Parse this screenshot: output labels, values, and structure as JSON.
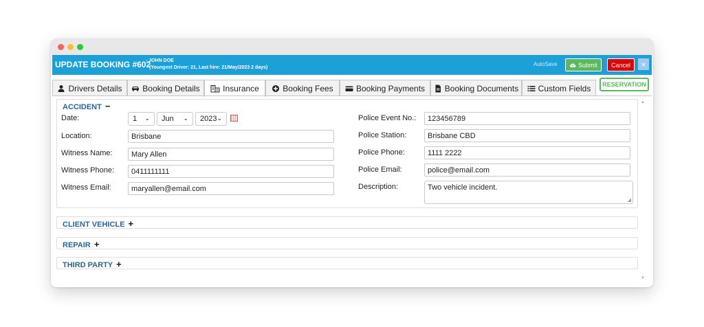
{
  "header": {
    "title": "UPDATE BOOKING #602",
    "driver_name": "- JOHN DOE",
    "driver_info": "(Youngest Driver: 21, Last hire: 21/May/2023 2 days)",
    "autosave": "AutoSave",
    "submit_label": "Submit",
    "cancel_label": "Cancel",
    "close_label": "×"
  },
  "tabs": [
    {
      "label": "Drivers Details",
      "icon": "person-icon"
    },
    {
      "label": "Booking Details",
      "icon": "car-icon"
    },
    {
      "label": "Insurance",
      "icon": "building-icon",
      "active": true
    },
    {
      "label": "Booking Fees",
      "icon": "plus-circle-icon"
    },
    {
      "label": "Booking Payments",
      "icon": "credit-card-icon"
    },
    {
      "label": "Booking Documents",
      "icon": "document-icon"
    },
    {
      "label": "Custom Fields",
      "icon": "list-icon"
    }
  ],
  "reservation_label": "RESERVATION",
  "accident": {
    "title": "ACCIDENT",
    "toggle": "−",
    "date_label": "Date:",
    "date_day": "1",
    "date_month": "Jun",
    "date_year": "2023",
    "location_label": "Location:",
    "location": "Brisbane",
    "witness_name_label": "Witness Name:",
    "witness_name": "Mary Allen",
    "witness_phone_label": "Witness Phone:",
    "witness_phone": "0411111111",
    "witness_email_label": "Witness Email:",
    "witness_email": "maryallen@email.com",
    "police_event_label": "Police Event No.:",
    "police_event": "123456789",
    "police_station_label": "Police Station:",
    "police_station": "Brisbane CBD",
    "police_phone_label": "Police Phone:",
    "police_phone": "1111 2222",
    "police_email_label": "Police Email:",
    "police_email": "police@email.com",
    "description_label": "Description:",
    "description": "Two vehicle incident."
  },
  "sections": [
    {
      "title": "CLIENT VEHICLE",
      "toggle": "+"
    },
    {
      "title": "REPAIR",
      "toggle": "+"
    },
    {
      "title": "THIRD PARTY",
      "toggle": "+"
    }
  ],
  "colors": {
    "header_bg": "#1ba0d8",
    "submit": "#5cb85c",
    "cancel": "#e00000",
    "section_title": "#2a6496"
  }
}
